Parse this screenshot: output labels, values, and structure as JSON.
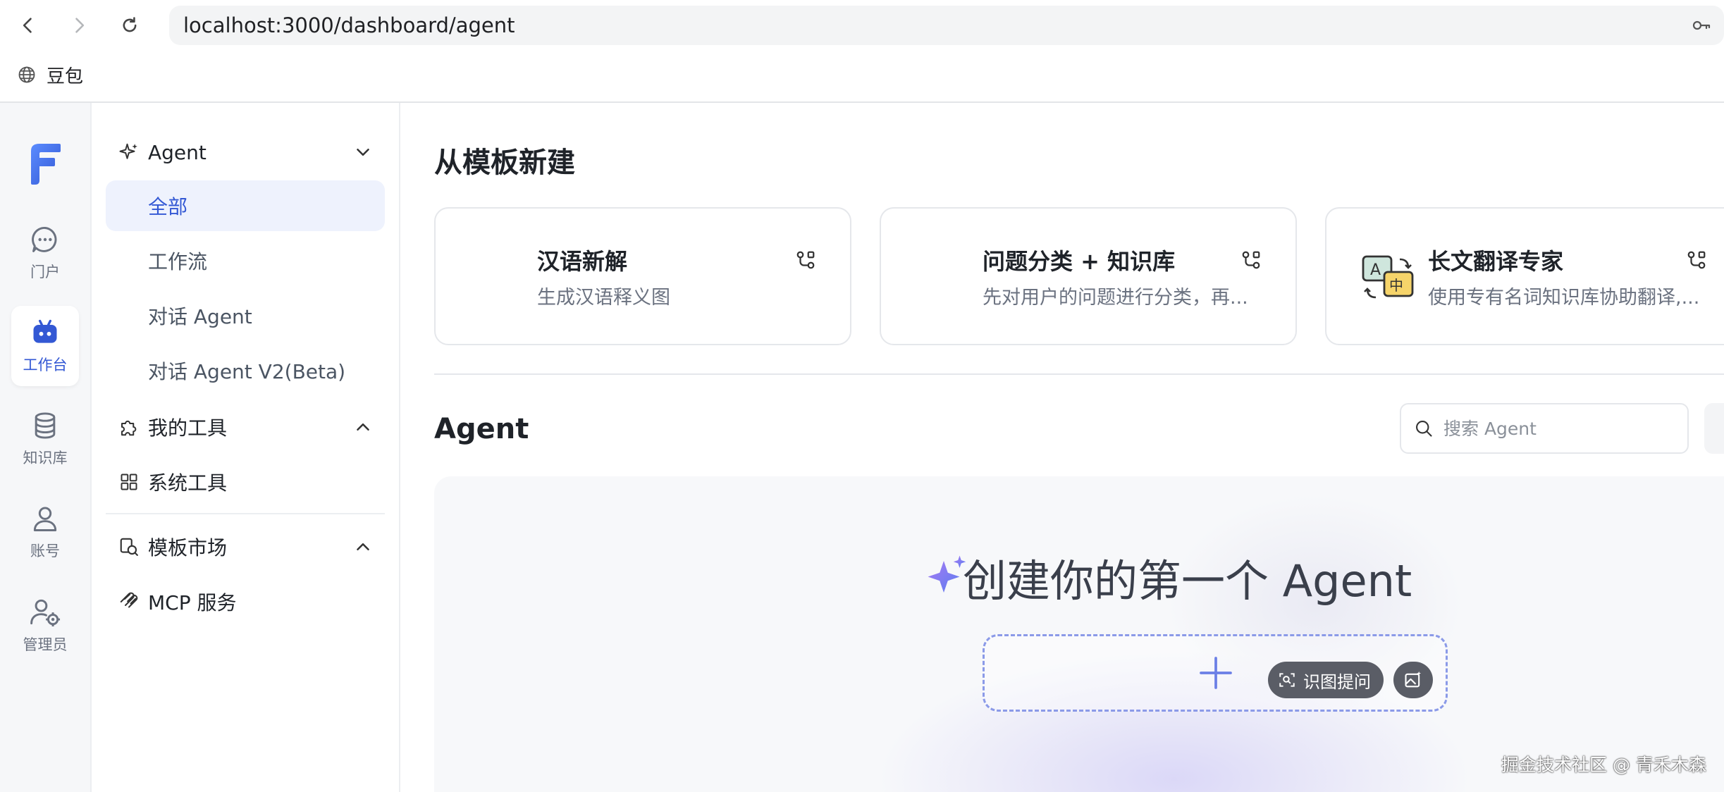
{
  "browser": {
    "url": "localhost:3000/dashboard/agent",
    "bookmark": "豆包"
  },
  "rail": {
    "items": [
      {
        "label": "门户"
      },
      {
        "label": "工作台"
      },
      {
        "label": "知识库"
      },
      {
        "label": "账号"
      },
      {
        "label": "管理员"
      }
    ]
  },
  "sidebar": {
    "agent_group": "Agent",
    "agent_items": [
      "全部",
      "工作流",
      "对话 Agent",
      "对话 Agent V2(Beta)"
    ],
    "tools_group": "我的工具",
    "system_tools": "系统工具",
    "market_group": "模板市场",
    "mcp": "MCP 服务"
  },
  "main": {
    "template_title": "从模板新建",
    "templates": [
      {
        "title": "汉语新解",
        "desc": "生成汉语释义图"
      },
      {
        "title": "问题分类 + 知识库",
        "desc": "先对用户的问题进行分类，再..."
      },
      {
        "title": "长文翻译专家",
        "desc": "使用专有名词知识库协助翻译,..."
      }
    ],
    "agent_title": "Agent",
    "search_placeholder": "搜索 Agent",
    "empty_title": "创建你的第一个 Agent",
    "image_question": "识图提问"
  },
  "watermark": "掘金技术社区 @ 青禾木森",
  "colors": {
    "accent": "#3358d4",
    "active_bg": "#eef2fd",
    "dashed": "#8b9ae8"
  }
}
